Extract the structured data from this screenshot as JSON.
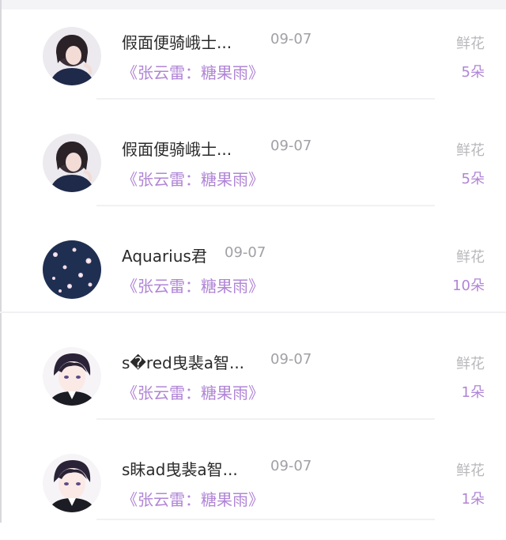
{
  "gift_list": {
    "items": [
      {
        "user_name": "假面便骑峨士...",
        "date": "09-07",
        "work_title": "《张云雷：糖果雨》",
        "gift_type": "鲜花",
        "gift_count": "5朵",
        "avatar_icon": "girl-short-hair-avatar"
      },
      {
        "user_name": "假面便骑峨士...",
        "date": "09-07",
        "work_title": "《张云雷：糖果雨》",
        "gift_type": "鲜花",
        "gift_count": "5朵",
        "avatar_icon": "girl-short-hair-avatar"
      },
      {
        "user_name": "Aquarius君",
        "date": "09-07",
        "work_title": "《张云雷：糖果雨》",
        "gift_type": "鲜花",
        "gift_count": "10朵",
        "avatar_icon": "sakura-navy-avatar"
      },
      {
        "user_name": "s�red曳裴a智...",
        "date": "09-07",
        "work_title": "《张云雷：糖果雨》",
        "gift_type": "鲜花",
        "gift_count": "1朵",
        "avatar_icon": "anime-boy-avatar"
      },
      {
        "user_name": "s眜ad曳裴a智...",
        "date": "09-07",
        "work_title": "《张云雷：糖果雨》",
        "gift_type": "鲜花",
        "gift_count": "1朵",
        "avatar_icon": "anime-boy-avatar"
      }
    ]
  },
  "colors": {
    "accent_purple": "#b085d6",
    "muted_gray": "#a0a0a6",
    "name_text": "#2a2a2a"
  }
}
